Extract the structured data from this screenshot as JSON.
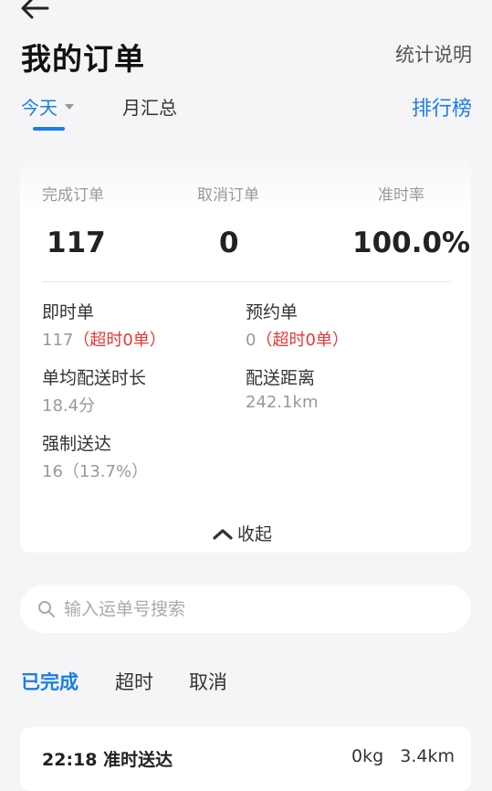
{
  "header": {
    "title": "我的订单",
    "stats_link": "统计说明",
    "tabs": {
      "today": "今天",
      "month": "月汇总"
    },
    "rank_link": "排行榜"
  },
  "summary": {
    "completed": {
      "label": "完成订单",
      "value": "117"
    },
    "cancelled": {
      "label": "取消订单",
      "value": "0"
    },
    "on_time_rate": {
      "label": "准时率",
      "value": "100.0%"
    }
  },
  "details": {
    "instant": {
      "label": "即时单",
      "value": "117",
      "overtime": "（超时0单）"
    },
    "scheduled": {
      "label": "预约单",
      "value": "0",
      "overtime": "（超时0单）"
    },
    "avg_duration": {
      "label": "单均配送时长",
      "value": "18.4分"
    },
    "distance": {
      "label": "配送距离",
      "value": "242.1km"
    },
    "forced": {
      "label": "强制送达",
      "value": "16（13.7%）"
    }
  },
  "collapse_label": "收起",
  "search": {
    "placeholder": "输入运单号搜索"
  },
  "filter_tabs": [
    "已完成",
    "超时",
    "取消"
  ],
  "orders": [
    {
      "time_status": "22:18 准时送达",
      "weight": "0kg",
      "distance": "3.4km"
    }
  ],
  "colors": {
    "accent": "#1a7ee6",
    "warning": "#e53935"
  }
}
